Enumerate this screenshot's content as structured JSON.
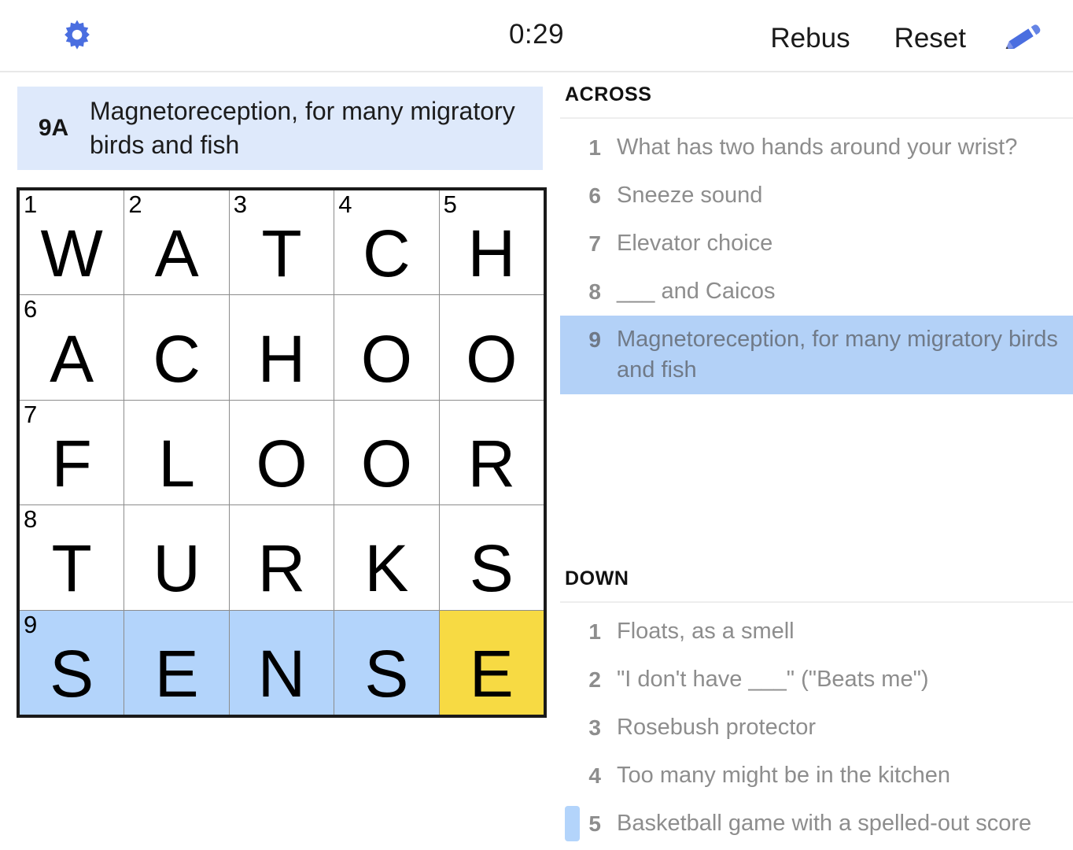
{
  "toolbar": {
    "gear_icon": "gear-icon",
    "timer": "0:29",
    "rebus_label": "Rebus",
    "reset_label": "Reset",
    "pencil_icon": "pencil-icon"
  },
  "current_clue": {
    "number_label": "9A",
    "text": "Magnetoreception, for many migratory birds and fish"
  },
  "grid": {
    "rows": 5,
    "cols": 5,
    "cells": [
      [
        {
          "num": "1",
          "letter": "W",
          "state": "normal"
        },
        {
          "num": "2",
          "letter": "A",
          "state": "normal"
        },
        {
          "num": "3",
          "letter": "T",
          "state": "normal"
        },
        {
          "num": "4",
          "letter": "C",
          "state": "normal"
        },
        {
          "num": "5",
          "letter": "H",
          "state": "normal"
        }
      ],
      [
        {
          "num": "6",
          "letter": "A",
          "state": "normal"
        },
        {
          "num": "",
          "letter": "C",
          "state": "normal"
        },
        {
          "num": "",
          "letter": "H",
          "state": "normal"
        },
        {
          "num": "",
          "letter": "O",
          "state": "normal"
        },
        {
          "num": "",
          "letter": "O",
          "state": "normal"
        }
      ],
      [
        {
          "num": "7",
          "letter": "F",
          "state": "normal"
        },
        {
          "num": "",
          "letter": "L",
          "state": "normal"
        },
        {
          "num": "",
          "letter": "O",
          "state": "normal"
        },
        {
          "num": "",
          "letter": "O",
          "state": "normal"
        },
        {
          "num": "",
          "letter": "R",
          "state": "normal"
        }
      ],
      [
        {
          "num": "8",
          "letter": "T",
          "state": "normal"
        },
        {
          "num": "",
          "letter": "U",
          "state": "normal"
        },
        {
          "num": "",
          "letter": "R",
          "state": "normal"
        },
        {
          "num": "",
          "letter": "K",
          "state": "normal"
        },
        {
          "num": "",
          "letter": "S",
          "state": "normal"
        }
      ],
      [
        {
          "num": "9",
          "letter": "S",
          "state": "highlight"
        },
        {
          "num": "",
          "letter": "E",
          "state": "highlight"
        },
        {
          "num": "",
          "letter": "N",
          "state": "highlight"
        },
        {
          "num": "",
          "letter": "S",
          "state": "highlight"
        },
        {
          "num": "",
          "letter": "E",
          "state": "cursor"
        }
      ]
    ]
  },
  "across": {
    "heading": "ACROSS",
    "clues": [
      {
        "num": "1",
        "text": "What has two hands around your wrist?",
        "active": false,
        "bar": false
      },
      {
        "num": "6",
        "text": "Sneeze sound",
        "active": false,
        "bar": false
      },
      {
        "num": "7",
        "text": "Elevator choice",
        "active": false,
        "bar": false
      },
      {
        "num": "8",
        "text": "___ and Caicos",
        "active": false,
        "bar": false
      },
      {
        "num": "9",
        "text": "Magnetoreception, for many migratory birds and fish",
        "active": true,
        "bar": false
      }
    ]
  },
  "down": {
    "heading": "DOWN",
    "clues": [
      {
        "num": "1",
        "text": "Floats, as a smell",
        "active": false,
        "bar": false
      },
      {
        "num": "2",
        "text": "\"I don't have ___\" (\"Beats me\")",
        "active": false,
        "bar": false
      },
      {
        "num": "3",
        "text": "Rosebush protector",
        "active": false,
        "bar": false
      },
      {
        "num": "4",
        "text": "Too many might be in the kitchen",
        "active": false,
        "bar": false
      },
      {
        "num": "5",
        "text": "Basketball game with a spelled-out score",
        "active": false,
        "bar": true
      }
    ]
  },
  "colors": {
    "accent_blue": "#4a6ee0",
    "cell_highlight": "#b3d4fb",
    "cursor_yellow": "#f7da43",
    "banner_bg": "#dee9fb",
    "clue_active_bg": "#b3d1f7"
  }
}
